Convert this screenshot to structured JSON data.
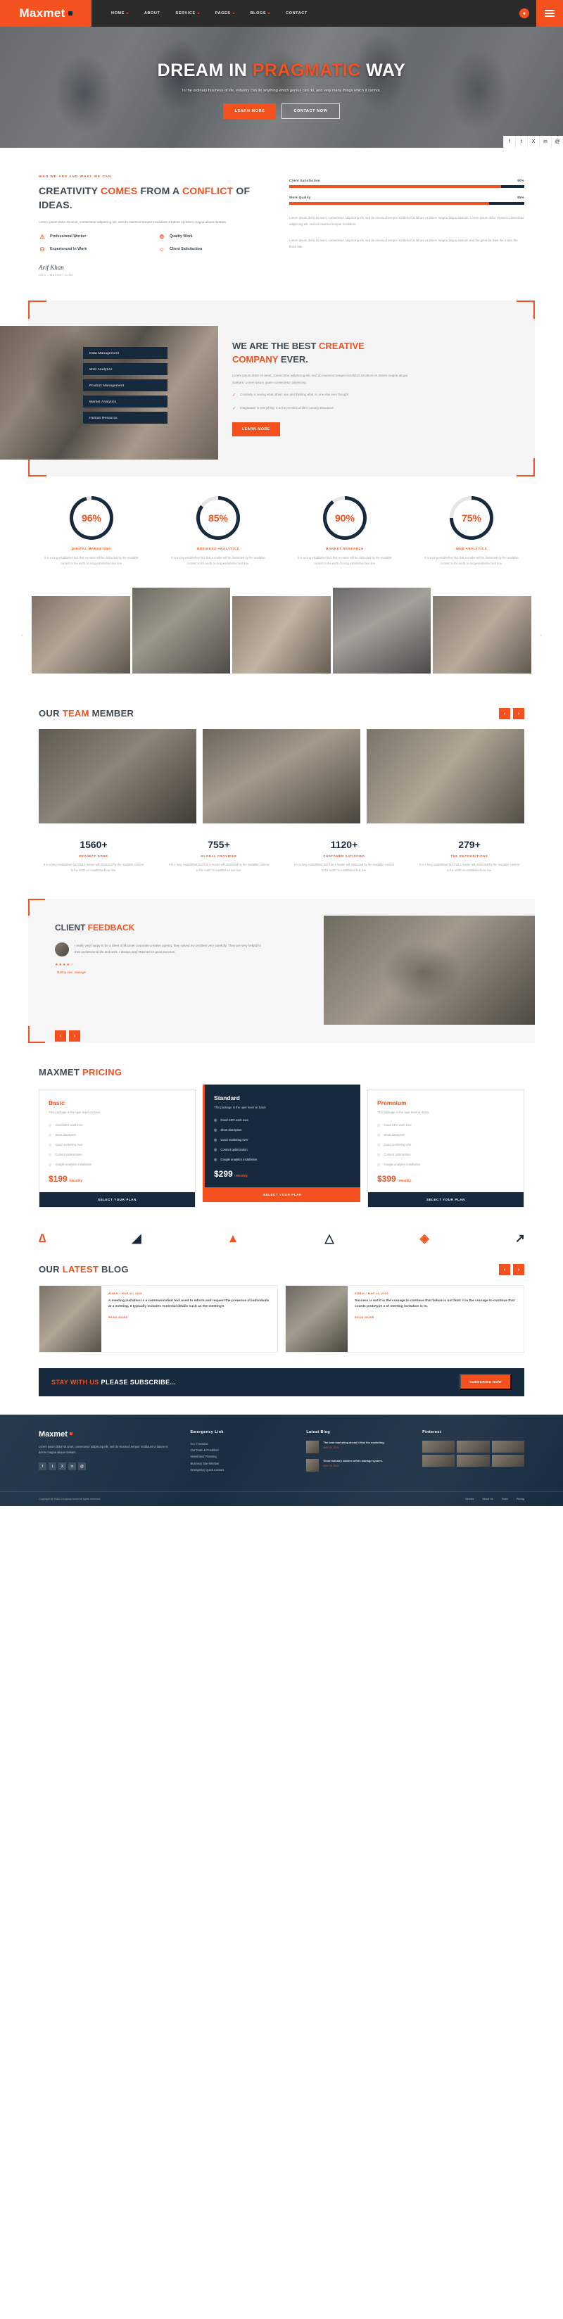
{
  "brand": {
    "name": "Maxmet",
    "accent": "#f4511e",
    "dark": "#16293d"
  },
  "header": {
    "nav": [
      {
        "label": "HOME",
        "caret": true
      },
      {
        "label": "ABOUT",
        "caret": false
      },
      {
        "label": "SERVICE",
        "caret": true
      },
      {
        "label": "PAGES",
        "caret": true
      },
      {
        "label": "BLOGS",
        "caret": true
      },
      {
        "label": "CONTACT",
        "caret": false
      }
    ],
    "search_icon": "search-icon",
    "menu_icon": "hamburger-icon"
  },
  "hero": {
    "title_1": "DREAM IN ",
    "title_accent": "PRAGMATIC",
    "title_2": " WAY",
    "paragraph": "In the ordinary business of life, industry can do anything which genius can do, and very many things which it cannot.",
    "btn_primary": "LEARN MORE",
    "btn_secondary": "CONTACT NOW",
    "socials": [
      "f",
      "t",
      "X",
      "in",
      "@"
    ]
  },
  "about": {
    "eyebrow": "WHO WE ARE AND WHAT WE CAN",
    "title_1": "CREATIVITY ",
    "title_accent1": "COMES",
    "title_2": " FROM A ",
    "title_accent2": "CONFLICT",
    "title_3": " OF IDEAS.",
    "paragraph": "Lorem ipsum dolor sit amet, consectetur adipiscing elit, sed do eiusmod tempor incididunt ut labore et dolore magna aliqua duskam.",
    "paragraph2": "Lorem ipsum dolor sit amet consectetur adipiscing elit, sed do eiusmod tempor incididunt ut labore et dolore magna aliqua duskam.",
    "features": [
      {
        "icon": "cone-icon",
        "glyph": "⚠",
        "label": "Professional Worker"
      },
      {
        "icon": "gear-icon",
        "glyph": "⚙",
        "label": "Quality Work"
      },
      {
        "icon": "team-icon",
        "glyph": "⚇",
        "label": "Experienced In Work"
      },
      {
        "icon": "smile-icon",
        "glyph": "☺",
        "label": "Client Satisfaction"
      }
    ],
    "signature_name": "Arif Khan",
    "signature_role": "CEO - MAXMET.COM",
    "bars": [
      {
        "label": "Client Satisfaction",
        "value": 90,
        "value_text": "90%"
      },
      {
        "label": "Work Quality",
        "value": 85,
        "value_text": "85%"
      }
    ],
    "bars_text1": "Lorem ipsum dolor sit amet, consectetur adipiscing elit, sed do eiusmod tempor incididunt ut labore et dolore magna aliqua duskam. Lorem ipsum dolor sit amet consectetur adipiscing elit, sed do eiusmod tempor incididunt.",
    "bars_text2": "Lorem ipsum dolor sit amet, consectetur adipiscing elit, sed do eiusmod tempor incididunt ut labore et dolore magna aliqua duskam and the great be thes the it also the finish late."
  },
  "creative": {
    "tags": [
      "Data Management",
      "Web Analytics",
      "Product Management",
      "Market Analytics",
      "Human Resource"
    ],
    "title_1": "WE ARE THE BEST ",
    "title_accent": "CREATIVE COMPANY",
    "title_2": " EVER.",
    "paragraph": "Lorem ipsum dolor sit amet, consectetur adipiscing elit, sed do eiusmod tempor incididunt ut labore et dolore magna aliqua duskam. Lorem ipsum quam consectetur adipiscing.",
    "checks": [
      "Creativity is seeing what others see and thinking what no one else ever thought",
      "Imagination is everything. It is the preview of life's coming attractions"
    ],
    "button": "LEARN MORE"
  },
  "skills": [
    {
      "value": "96%",
      "percent": 96,
      "label": "DIGITAL MARKETING",
      "text": "It is a long established fact that a reader will be distracted by the readable content to the earth on long established text line."
    },
    {
      "value": "85%",
      "percent": 85,
      "label": "BUSINESS ANALYTICS",
      "text": "It is a long established fact that a reader will be distracted by the readable content to the earth on long established text line."
    },
    {
      "value": "90%",
      "percent": 90,
      "label": "MARKET RESEARCH",
      "text": "It is a long established fact that a reader will be distracted by the readable content to the earth on long established text line."
    },
    {
      "value": "75%",
      "percent": 75,
      "label": "WEB ANALYTICS",
      "text": "It is a long established fact that a reader will be distracted by the readable content to the earth on long established text line."
    }
  ],
  "team": {
    "title_1": "OUR ",
    "title_accent": "TEAM",
    "title_2": " MEMBER",
    "prev": "‹",
    "next": "›"
  },
  "counters": [
    {
      "num": "1560+",
      "label": "PROJECT DONE",
      "text": "It is a long established fact that a reader will distracted by the readable content to the earth on established text line."
    },
    {
      "num": "755+",
      "label": "GLOBAL PROVIDER",
      "text": "It is a long established fact that a reader will distracted by the readable content to the earth on established text line."
    },
    {
      "num": "1120+",
      "label": "CUSTOMER SATISFIED",
      "text": "It is a long established fact that a reader will distracted by the readable content to the earth on established text line."
    },
    {
      "num": "279+",
      "label": "THE RECOGNITIONS",
      "text": "It is a long established fact that a reader will distracted by the readable content to the earth on established text line."
    }
  ],
  "feedback": {
    "title_1": "CLIENT ",
    "title_accent": "FEEDBACK",
    "quote": "I really very happy to be a client of Maxmet corporate creative agency. they solved my problem very carefully. They are very helpful to their professional life and work. I always pray Maxmet for good success.",
    "stars": "★★★★☆",
    "name": "Martha Alex",
    "role": "Manager",
    "prev": "‹",
    "next": "›"
  },
  "pricing": {
    "title_1": "MAXMET ",
    "title_accent": "PRICING",
    "plans": [
      {
        "name": "Basic",
        "sub": "This package is the uper level on basic",
        "features": [
          "Good SEO work ever",
          "Short discription",
          "Good marketing ever",
          "Content optimization",
          "Google analytics installation"
        ],
        "price": "$199",
        "period": "/ Monthly",
        "button": "SELECT YOUR PLAN",
        "featured": false
      },
      {
        "name": "Standard",
        "sub": "This package is the uper level on basic",
        "features": [
          "Good SEO work ever",
          "Short discription",
          "Good marketing ever",
          "Content optimization",
          "Google analytics installation"
        ],
        "price": "$299",
        "period": "/ Monthly",
        "button": "SELECT YOUR PLAN",
        "featured": true
      },
      {
        "name": "Premnium",
        "sub": "This package is the uper level on basic",
        "features": [
          "Good SEO work ever",
          "Short discription",
          "Good marketing ever",
          "Content optimization",
          "Google analytics installation"
        ],
        "price": "$399",
        "period": "/ Monthly",
        "button": "SELECT YOUR PLAN",
        "featured": false
      }
    ]
  },
  "brands": [
    {
      "glyph": "∆",
      "dark": false
    },
    {
      "glyph": "◢",
      "dark": true
    },
    {
      "glyph": "▲",
      "dark": false
    },
    {
      "glyph": "△",
      "dark": true
    },
    {
      "glyph": "◈",
      "dark": false
    },
    {
      "glyph": "↗",
      "dark": true
    }
  ],
  "blog": {
    "title_1": "OUR ",
    "title_accent": "LATEST",
    "title_2": " BLOG",
    "prev": "‹",
    "next": "›",
    "posts": [
      {
        "meta": "ADMIN  /  MAR 25, 2020",
        "headline": "A meeting invitation is a communication tool used to inform and request the presence of individuals at a meeting. It typically includes essential details such as the meeting's",
        "more": "READ MORE"
      },
      {
        "meta": "ADMIN  /  MAR 25, 2020",
        "headline": "Success is not it is the courage to continue that failure is not fatal: it is the courage to continue that counts prototype a of meeting invitation is to.",
        "more": "READ MORE"
      }
    ]
  },
  "subscribe": {
    "title_1": "STAY WITH US ",
    "title_rest": "PLEASE SUBSCRIBE...",
    "button": "SUBSCRIBE NOW"
  },
  "footer": {
    "logo": "Maxmet",
    "about": "Lorem ipsum dolor sit amet, consectetur adipiscing elit, sed do eiusmod tempor incididunt ut labore et dolore magna aliqua duskam.",
    "socials": [
      "f",
      "t",
      "X",
      "in",
      "@"
    ],
    "col2_title": "Emergency Link",
    "col2_links": [
      "24 / 7 Service",
      "Our Team & Condition",
      "Investment Planning",
      "Business Site Member",
      "Emergency Quick Contact"
    ],
    "col3_title": "Latest Blog",
    "col3_posts": [
      {
        "text": "The best marketing ahead it that the marketing.",
        "date": "MAR 25, 2020"
      },
      {
        "text": "Great industry leaders offers manage system.",
        "date": "MAR 25, 2020"
      }
    ],
    "col4_title": "Pinterest",
    "copyright_1": "Copyright @ 2020 Company name All rights reserved.",
    "copyright_accent": "",
    "bottom_links": [
      "Service",
      "About Us",
      "Team",
      "Pricing"
    ]
  }
}
